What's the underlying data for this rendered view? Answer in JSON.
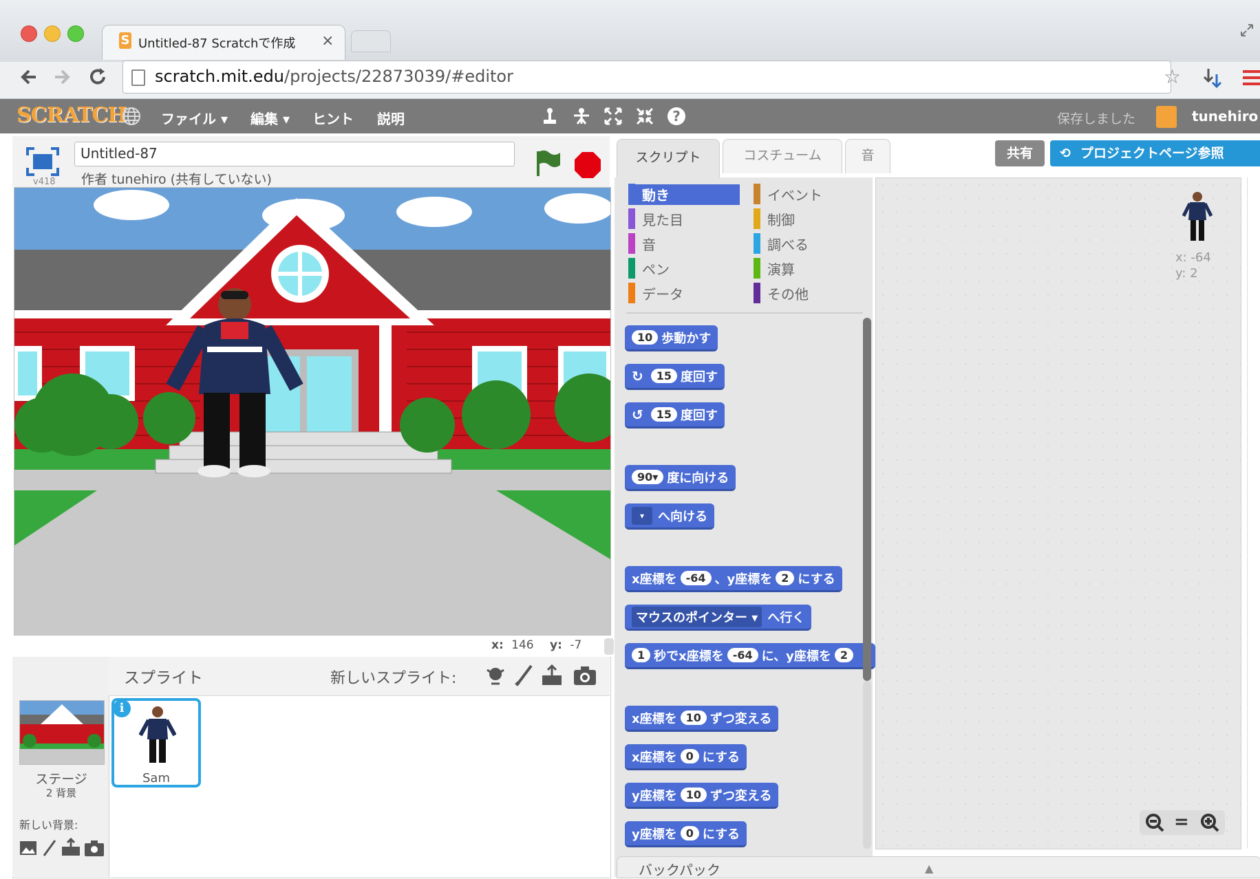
{
  "browser": {
    "tab_title": "Untitled-87 Scratchで作成",
    "tab_close": "×",
    "url_host": "scratch.mit.edu",
    "url_path": "/projects/22873039/#editor"
  },
  "menubar": {
    "logo": "SCRATCH",
    "items": [
      "ファイル ▾",
      "編集 ▾",
      "ヒント",
      "説明"
    ],
    "saved_text": "保存しました",
    "username": "tunehiro ▾"
  },
  "stage_header": {
    "project_title": "Untitled-87",
    "author": "作者 tunehiro (共有していない)",
    "version": "v418"
  },
  "stage": {
    "mouse_x_label": "x:",
    "mouse_x": "146",
    "mouse_y_label": "y:",
    "mouse_y": "-7"
  },
  "tabs": {
    "scripts": "スクリプト",
    "costumes": "コスチューム",
    "sounds": "音",
    "share": "共有",
    "project_page": "プロジェクトページ参照"
  },
  "categories": {
    "left": [
      {
        "label": "動き",
        "color": "#4a6cd4"
      },
      {
        "label": "見た目",
        "color": "#8a55d7"
      },
      {
        "label": "音",
        "color": "#bb42c3"
      },
      {
        "label": "ペン",
        "color": "#0e9a6c"
      },
      {
        "label": "データ",
        "color": "#ee7d16"
      }
    ],
    "right": [
      {
        "label": "イベント",
        "color": "#c88330"
      },
      {
        "label": "制御",
        "color": "#e1a91a"
      },
      {
        "label": "調べる",
        "color": "#2ca5e2"
      },
      {
        "label": "演算",
        "color": "#5cb712"
      },
      {
        "label": "その他",
        "color": "#632d99"
      }
    ]
  },
  "blocks": {
    "move": {
      "num": "10",
      "text": "歩動かす"
    },
    "turn_right": {
      "num": "15",
      "text": "度回す"
    },
    "turn_left": {
      "num": "15",
      "text": "度回す"
    },
    "point_dir": {
      "num": "90▾",
      "text": "度に向ける"
    },
    "point_towards": {
      "text": "へ向ける"
    },
    "goto_xy": {
      "t1": "x座標を",
      "x": "-64",
      "t2": "、y座標を",
      "y": "2",
      "t3": "にする"
    },
    "goto_mouse": {
      "dropdown": "マウスのポインター ▾",
      "text": "へ行く"
    },
    "glide": {
      "secs": "1",
      "t1": "秒でx座標を",
      "x": "-64",
      "t2": "に、y座標を",
      "y": "2"
    },
    "change_x": {
      "t1": "x座標を",
      "num": "10",
      "t2": "ずつ変える"
    },
    "set_x": {
      "t1": "x座標を",
      "num": "0",
      "t2": "にする"
    },
    "change_y": {
      "t1": "y座標を",
      "num": "10",
      "t2": "ずつ変える"
    },
    "set_y": {
      "t1": "y座標を",
      "num": "0",
      "t2": "にする"
    }
  },
  "script_area": {
    "sprite_x": "x: -64",
    "sprite_y": "y: 2",
    "zoom_reset": "="
  },
  "sprite_panel": {
    "title": "スプライト",
    "new_sprite": "新しいスプライト:",
    "stage_label": "ステージ",
    "stage_backdrops": "2 背景",
    "new_backdrop": "新しい背景:",
    "sprite_name": "Sam",
    "info": "i"
  },
  "backpack": {
    "label": "バックパック",
    "arrow": "▲"
  }
}
